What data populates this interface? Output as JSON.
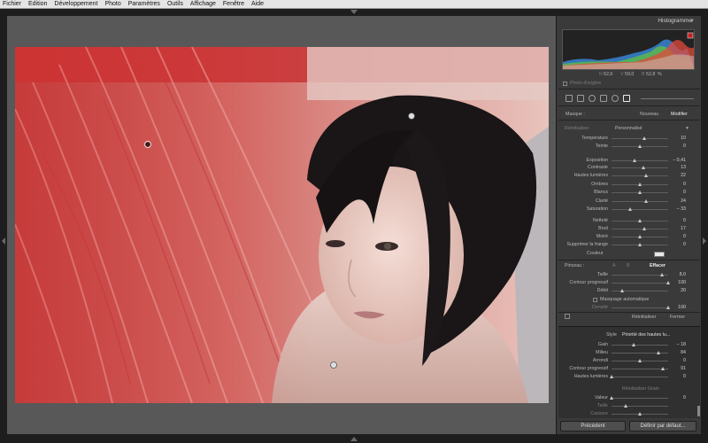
{
  "menu": [
    "Fichier",
    "Edition",
    "Développement",
    "Photo",
    "Paramètres",
    "Outils",
    "Affichage",
    "Fenêtre",
    "Aide"
  ],
  "histogram": {
    "title": "Histogramme",
    "r_label": "R",
    "r_value": "62,6",
    "v_label": "V",
    "v_value": "59,0",
    "b_label": "B",
    "b_value": "52,8",
    "percent": "%",
    "original_photo_label": "Photo d'origine"
  },
  "mask": {
    "label": "Masque :",
    "new_label": "Nouveau",
    "edit_label": "Modifier"
  },
  "effect": {
    "reset_label": "Réinitialiser",
    "preset_label": "Personnalisé",
    "rows": [
      {
        "label": "Température",
        "value": "10",
        "pos": 0.58
      },
      {
        "label": "Teinte",
        "value": "0",
        "pos": 0.5
      },
      {
        "label": "Exposition",
        "value": "– 0,41",
        "pos": 0.42
      },
      {
        "label": "Contraste",
        "value": "13",
        "pos": 0.57
      },
      {
        "label": "Hautes lumières",
        "value": "22",
        "pos": 0.61
      },
      {
        "label": "Ombres",
        "value": "0",
        "pos": 0.5
      },
      {
        "label": "Blancs",
        "value": "0",
        "pos": 0.5
      },
      {
        "label": "Clarté",
        "value": "24",
        "pos": 0.62
      },
      {
        "label": "Saturation",
        "value": "– 33",
        "pos": 0.33
      },
      {
        "label": "Netteté",
        "value": "0",
        "pos": 0.5
      },
      {
        "label": "Bruit",
        "value": "17",
        "pos": 0.59
      },
      {
        "label": "Moiré",
        "value": "0",
        "pos": 0.5
      },
      {
        "label": "Supprimer la frange",
        "value": "0",
        "pos": 0.5
      }
    ],
    "color_label": "Couleur"
  },
  "brush": {
    "label": "Pinceau :",
    "a_label": "A",
    "b_label": "B",
    "erase_label": "Effacer",
    "rows": [
      {
        "label": "Taille",
        "value": "8,0",
        "pos": 0.9
      },
      {
        "label": "Contour progressif",
        "value": "100",
        "pos": 1.0
      },
      {
        "label": "Débit",
        "value": "20",
        "pos": 0.2
      }
    ],
    "auto_mask_label": "Masquage automatique",
    "density_label": "Densité",
    "density_value": "100"
  },
  "footer": {
    "reset_label": "Réinitialiser",
    "close_label": "Fermer"
  },
  "grain_panel": {
    "style_label": "Style",
    "style_value": "Priorité des hautes lu...",
    "rows": [
      {
        "label": "Gain",
        "value": "– 18",
        "pos": 0.4
      },
      {
        "label": "Milieu",
        "value": "84",
        "pos": 0.84
      },
      {
        "label": "Arrondi",
        "value": "0",
        "pos": 0.5
      },
      {
        "label": "Contour progressif",
        "value": "91",
        "pos": 0.91
      },
      {
        "label": "Hautes lumières",
        "value": "0",
        "pos": 0.0
      }
    ],
    "grain_reset_label": "Réinitialiser Grain",
    "grain_rows": [
      {
        "label": "Valeur",
        "value": "0",
        "pos": 0.0
      },
      {
        "label": "Taille",
        "value": "",
        "pos": 0.25
      },
      {
        "label": "Cassure",
        "value": "",
        "pos": 0.5
      }
    ]
  },
  "buttons": {
    "previous": "Précédent",
    "set_default": "Définir par défaut..."
  },
  "colors": {
    "mask_overlay": "#e0403c",
    "histogram_red": "#e24a3a",
    "histogram_green": "#5fc23d",
    "histogram_blue": "#3a8be0"
  }
}
